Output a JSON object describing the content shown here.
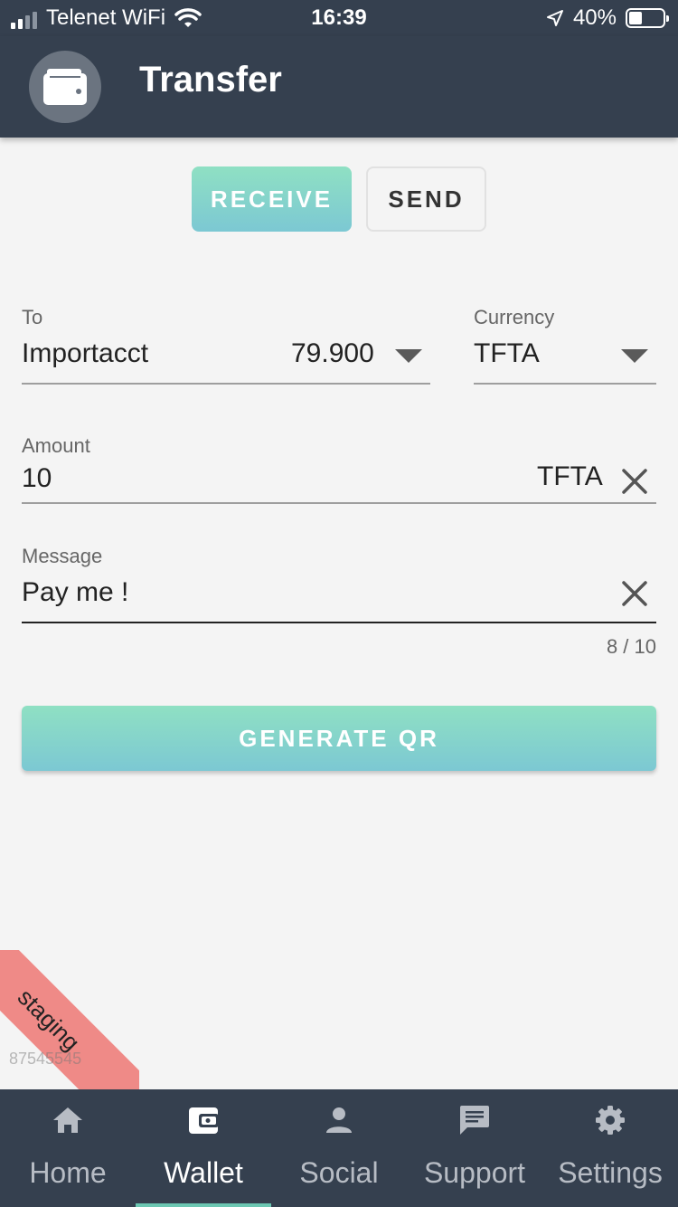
{
  "status_bar": {
    "carrier": "Telenet WiFi",
    "time": "16:39",
    "battery": "40%",
    "battery_level": 0.4
  },
  "app_bar": {
    "title": "Transfer",
    "avatar_icon": "wallet-icon"
  },
  "toggle": {
    "receive_label": "RECEIVE",
    "send_label": "SEND",
    "selected": "RECEIVE"
  },
  "form": {
    "to_label": "To",
    "to_value": "Importacct",
    "to_balance": "79.900",
    "currency_label": "Currency",
    "currency_value": "TFTA",
    "amount_label": "Amount",
    "amount_value": "10",
    "amount_suffix": "TFTA",
    "message_label": "Message",
    "message_value": "Pay me !",
    "message_counter": "8 / 10"
  },
  "generate_button": "GENERATE QR",
  "ribbon": {
    "label": "staging",
    "build_id": "87545545"
  },
  "bottom_nav": {
    "items": [
      {
        "label": "Home",
        "icon": "home-icon"
      },
      {
        "label": "Wallet",
        "icon": "wallet-icon"
      },
      {
        "label": "Social",
        "icon": "person-icon"
      },
      {
        "label": "Support",
        "icon": "chat-icon"
      },
      {
        "label": "Settings",
        "icon": "gear-icon"
      }
    ],
    "active": "Wallet"
  },
  "colors": {
    "bar": "#35404f",
    "accent_start": "#8fe0c3",
    "accent_end": "#7cc8d3",
    "ribbon": "#ef8a87"
  }
}
